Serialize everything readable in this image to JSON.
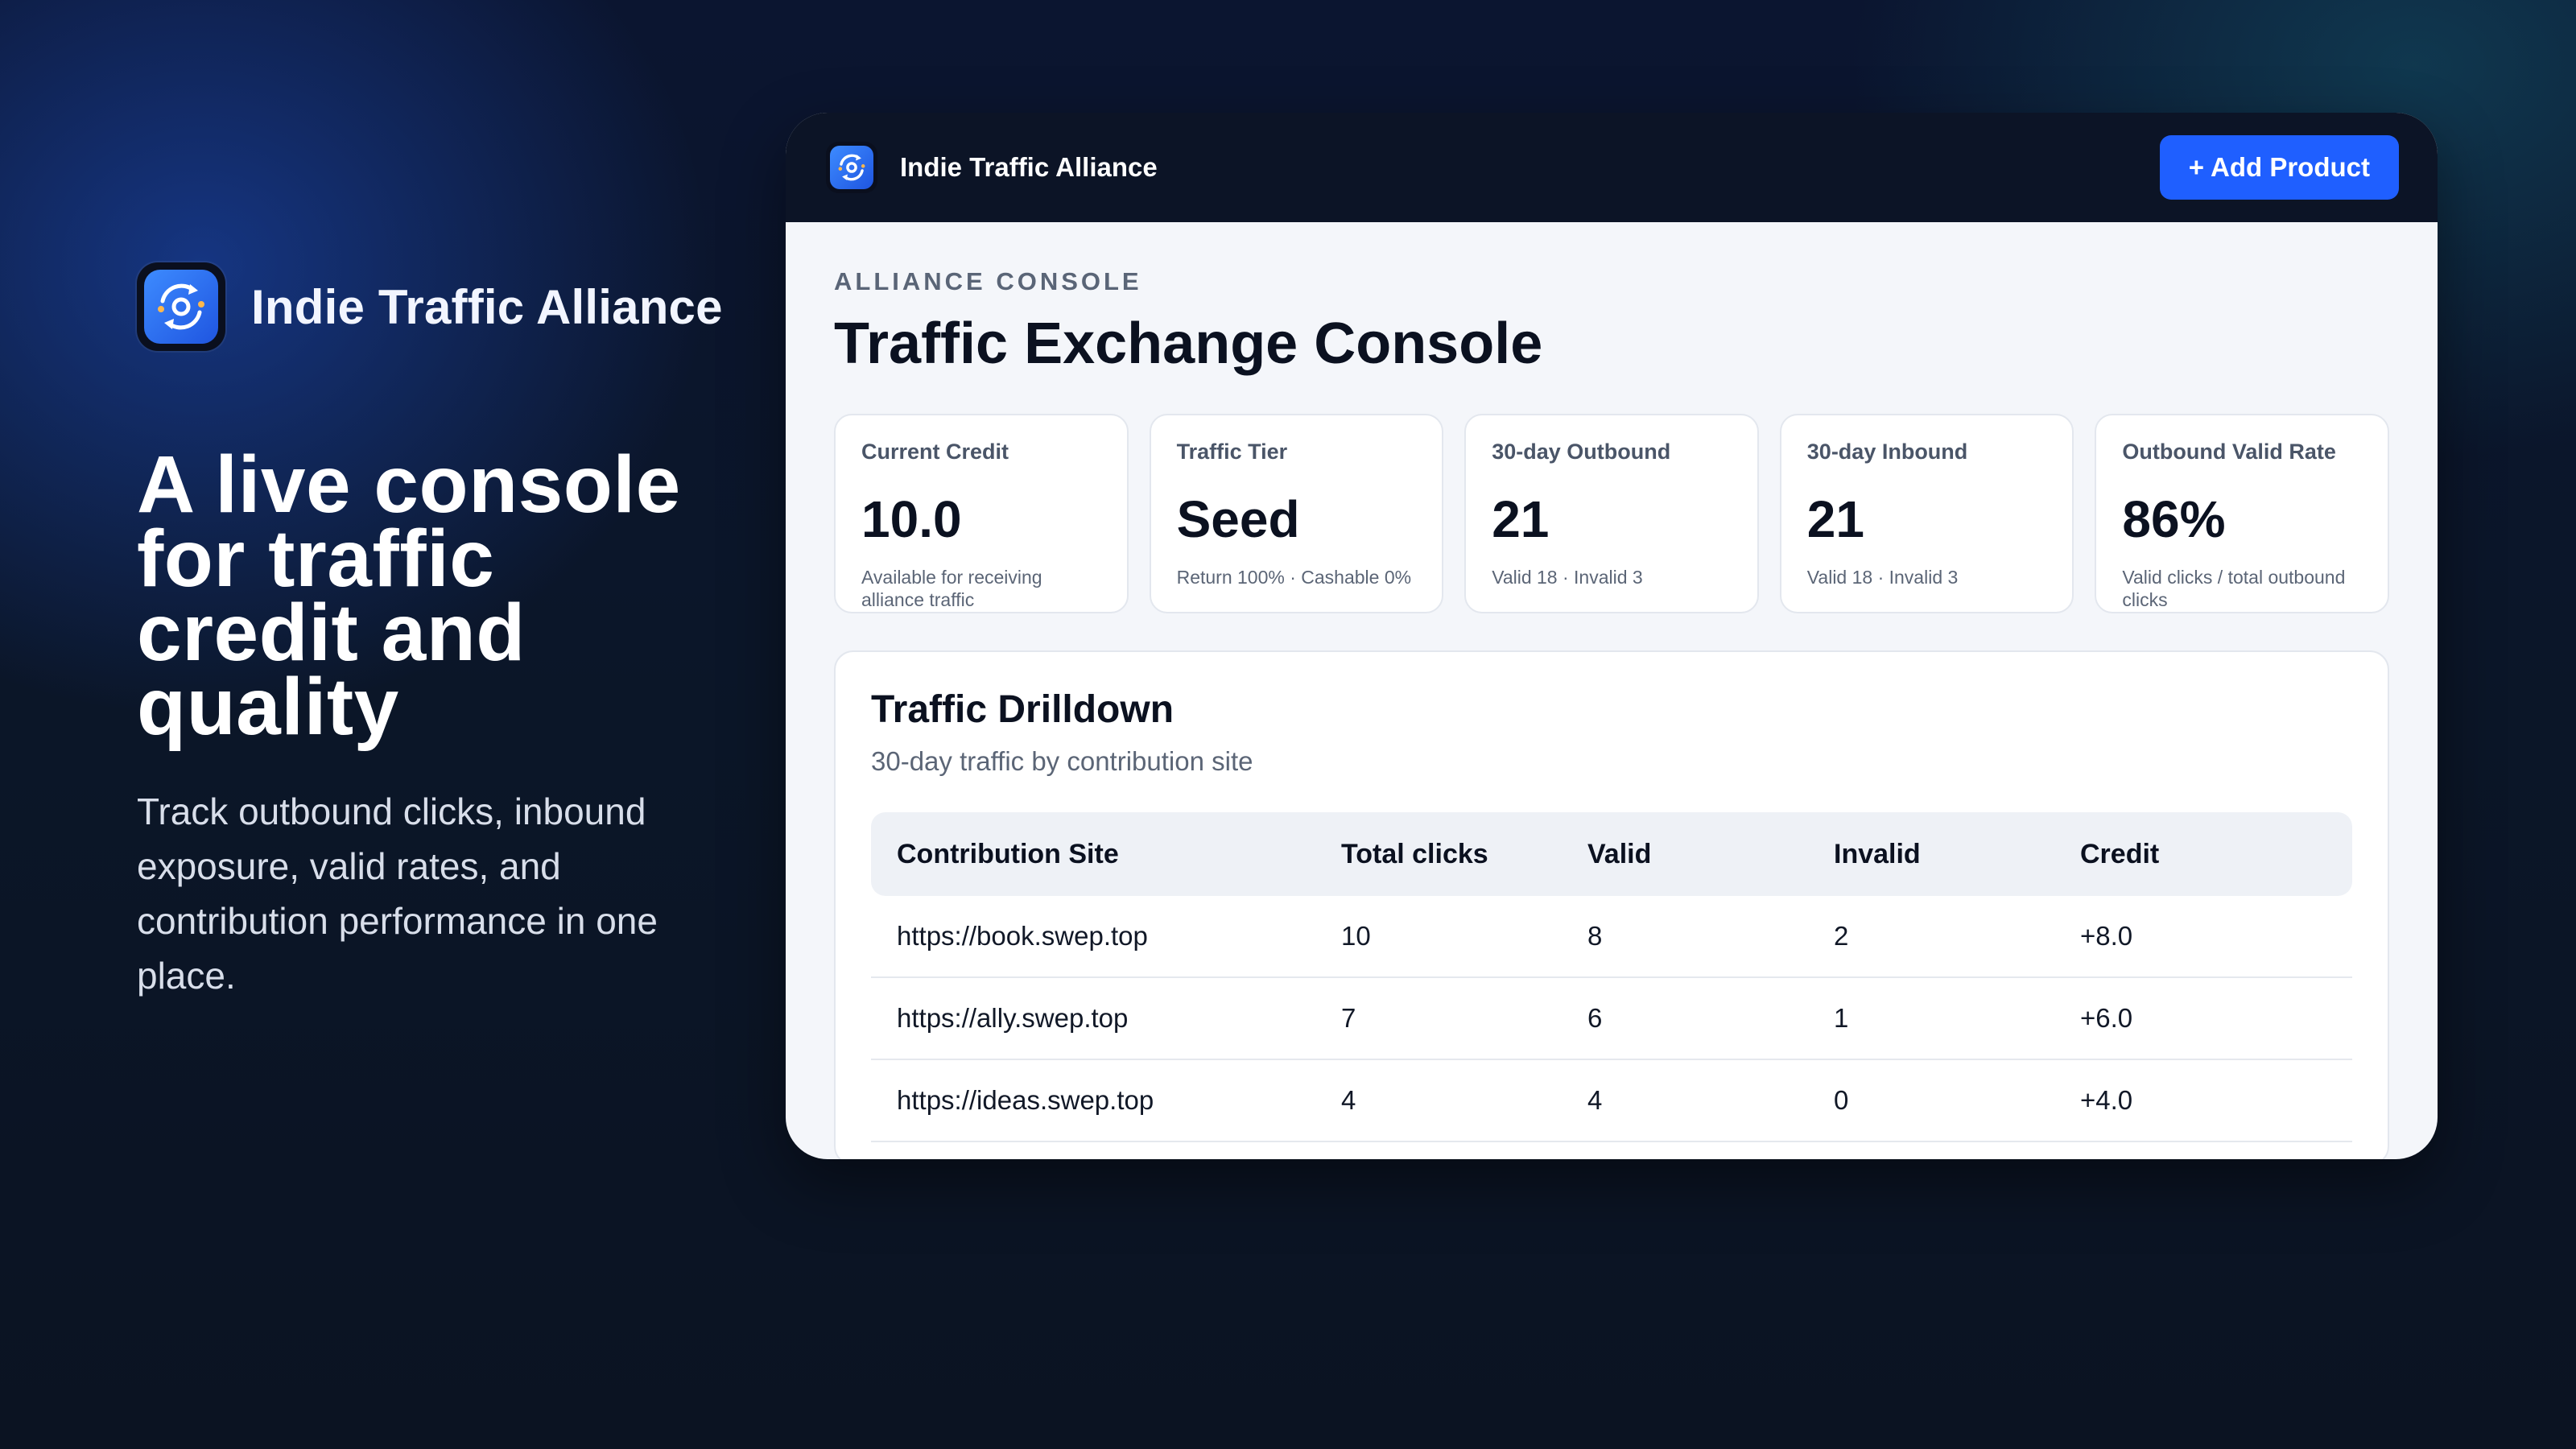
{
  "hero": {
    "brand_name": "Indie Traffic Alliance",
    "headline": "A live console for traffic credit and quality",
    "subtext": "Track outbound clicks, inbound exposure, valid rates, and contribution performance in one place."
  },
  "window": {
    "title": "Indie Traffic Alliance",
    "add_button": "+ Add Product",
    "eyebrow": "ALLIANCE CONSOLE",
    "page_title": "Traffic Exchange Console"
  },
  "stats": [
    {
      "label": "Current Credit",
      "value": "10.0",
      "note": "Available for receiving alliance traffic"
    },
    {
      "label": "Traffic Tier",
      "value": "Seed",
      "note": "Return 100% · Cashable 0%"
    },
    {
      "label": "30-day Outbound",
      "value": "21",
      "note": "Valid 18 · Invalid 3"
    },
    {
      "label": "30-day Inbound",
      "value": "21",
      "note": "Valid 18 · Invalid 3"
    },
    {
      "label": "Outbound Valid Rate",
      "value": "86%",
      "note": "Valid clicks / total outbound clicks"
    }
  ],
  "drilldown": {
    "title": "Traffic Drilldown",
    "subtitle": "30-day traffic by contribution site",
    "headers": [
      "Contribution Site",
      "Total clicks",
      "Valid",
      "Invalid",
      "Credit"
    ],
    "rows": [
      {
        "site": "https://book.swep.top",
        "total": "10",
        "valid": "8",
        "invalid": "2",
        "credit": "+8.0"
      },
      {
        "site": "https://ally.swep.top",
        "total": "7",
        "valid": "6",
        "invalid": "1",
        "credit": "+6.0"
      },
      {
        "site": "https://ideas.swep.top",
        "total": "4",
        "valid": "4",
        "invalid": "0",
        "credit": "+4.0"
      }
    ]
  },
  "colors": {
    "accent": "#1f5fff",
    "link": "#2459d6",
    "topbar": "#0c1426"
  },
  "icons": {
    "brand": "sync-target-icon"
  }
}
